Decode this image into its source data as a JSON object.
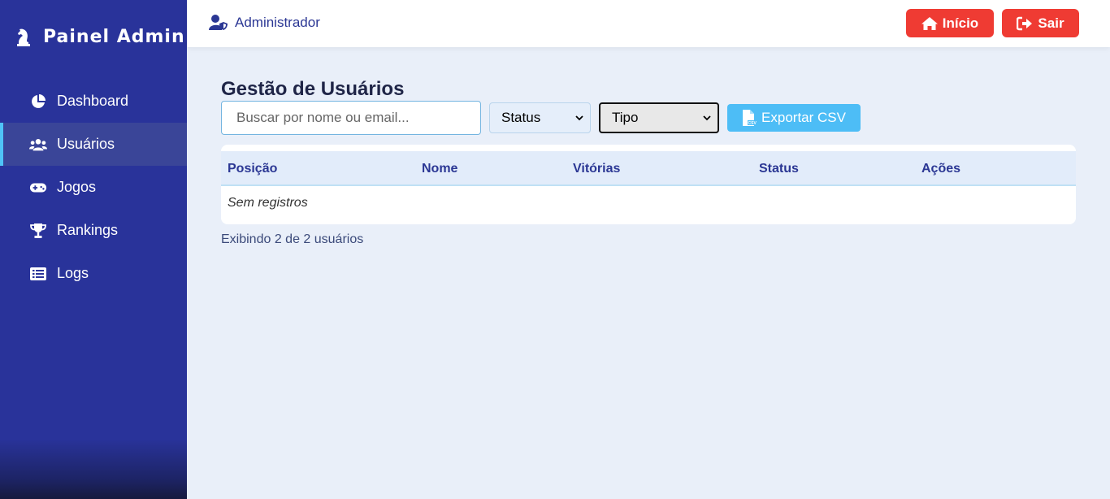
{
  "sidebar": {
    "brand": "Painel Admin",
    "items": [
      {
        "label": "Dashboard",
        "icon": "pie-chart-icon"
      },
      {
        "label": "Usuários",
        "icon": "users-icon",
        "active": true
      },
      {
        "label": "Jogos",
        "icon": "gamepad-icon"
      },
      {
        "label": "Rankings",
        "icon": "trophy-icon"
      },
      {
        "label": "Logs",
        "icon": "list-icon"
      }
    ]
  },
  "header": {
    "user": "Administrador",
    "home_label": "Início",
    "exit_label": "Sair"
  },
  "main": {
    "title": "Gestão de Usuários",
    "search_placeholder": "Buscar por nome ou email...",
    "status_select": "Status",
    "tipo_select": "Tipo",
    "export_label": "Exportar CSV",
    "columns": [
      "Posição",
      "Nome",
      "Vitórias",
      "Status",
      "Ações"
    ],
    "empty_text": "Sem registros",
    "count_text": "Exibindo 2 de 2 usuários"
  },
  "colors": {
    "sidebar": "#29339a",
    "accent": "#4fc3f7",
    "danger": "#ef3b33",
    "export": "#4dbdf6"
  }
}
